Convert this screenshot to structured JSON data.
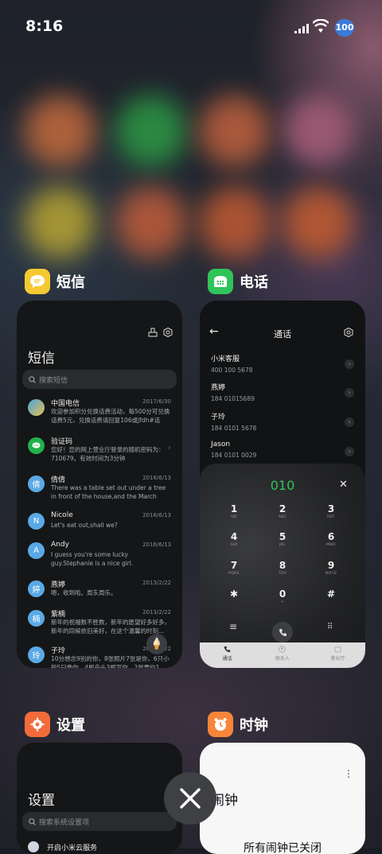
{
  "status_bar": {
    "time": "8:16",
    "battery": "100"
  },
  "apps": {
    "sms": {
      "title": "短信",
      "screen_title": "短信",
      "search_placeholder": "搜索短信",
      "messages": [
        {
          "avatar": "",
          "name": "中国电信",
          "date": "2017/6/30",
          "text": "欢迎参加积分兑换话费活动，每500分可兑换话费5元，兑换话费请回复106或jfdh#话费..."
        },
        {
          "avatar": "",
          "name": "验证码",
          "date": "",
          "text": "您好！您的网上营业厅登录的随机密码为：710679。有效时间为3分钟"
        },
        {
          "avatar": "倩",
          "name": "倩倩",
          "date": "2016/6/13",
          "text": "There was a table set out under a tree in front of the house,and the March Hare an..."
        },
        {
          "avatar": "N",
          "name": "Nicole",
          "date": "2016/6/13",
          "text": "Let's eat out,shall we?"
        },
        {
          "avatar": "A",
          "name": "Andy",
          "date": "2016/6/13",
          "text": "I guess you're some lucky guy.Stephanie is a nice girl."
        },
        {
          "avatar": "婷",
          "name": "燕婷",
          "date": "2013/2/22",
          "text": "嗯，收到啦。周东周乐。"
        },
        {
          "avatar": "楠",
          "name": "紫楠",
          "date": "2013/2/22",
          "text": "新年的祝福数不胜数，新年的愿望好多好多，新年的同候依旧美好，在这个温馨的时刻..."
        },
        {
          "avatar": "玲",
          "name": "子玲",
          "date": "2013/2/22",
          "text": "10分想念9别的你，8张照片7张是你，6只小船5只像你，4根舟头3根写你，2张要约1字..."
        }
      ]
    },
    "phone": {
      "title": "电话",
      "screen_title": "通话",
      "contacts": [
        {
          "name": "小米客服",
          "number": "400 100 5678"
        },
        {
          "name": "燕婷",
          "number": "184 01015689"
        },
        {
          "name": "子玲",
          "number": "184 0101 5678"
        },
        {
          "name": "Jason",
          "number": "184 0101 0029"
        }
      ],
      "dialed": "010",
      "keys": [
        {
          "d": "1",
          "l": "QD"
        },
        {
          "d": "2",
          "l": "ABC"
        },
        {
          "d": "3",
          "l": "DEF"
        },
        {
          "d": "4",
          "l": "GHI"
        },
        {
          "d": "5",
          "l": "JKL"
        },
        {
          "d": "6",
          "l": "MNO"
        },
        {
          "d": "7",
          "l": "PQRS"
        },
        {
          "d": "8",
          "l": "TUV"
        },
        {
          "d": "9",
          "l": "WXYZ"
        },
        {
          "d": "✱",
          "l": ""
        },
        {
          "d": "0",
          "l": "+"
        },
        {
          "d": "#",
          "l": ""
        }
      ],
      "tabs": [
        "通话",
        "联系人",
        "营业厅"
      ]
    },
    "settings": {
      "title": "设置",
      "screen_title": "设置",
      "search_placeholder": "搜索系统设置项",
      "first_item": "开启小米云服务"
    },
    "clock": {
      "title": "时钟",
      "screen_title": "闹钟",
      "empty_text": "所有闹钟已关闭"
    }
  },
  "colors": {
    "sms_icon": "#f5c932",
    "phone_icon": "#2fc45a",
    "settings_icon": "#f36b3b",
    "clock_icon": "#f7853a",
    "accent_green": "#2fc45a",
    "battery": "#3b7bd8"
  }
}
